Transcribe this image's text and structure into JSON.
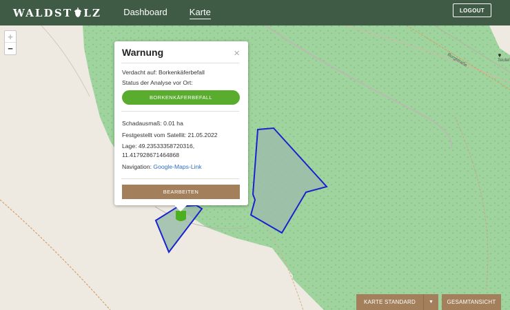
{
  "header": {
    "logo_left": "WALDST",
    "logo_right": "LZ",
    "nav": [
      {
        "label": "Dashboard",
        "active": false
      },
      {
        "label": "Karte",
        "active": true
      }
    ],
    "logout_label": "LOGOUT"
  },
  "map": {
    "zoom_in": "+",
    "zoom_out": "−",
    "street_label": "Burgstraße",
    "place_label": "Teufel",
    "colors": {
      "forest": "#9fd39c",
      "land": "#eeeae2",
      "polygon": "#1a22d0",
      "marker": "#4caf1e"
    }
  },
  "popup": {
    "title": "Warnung",
    "close": "×",
    "suspicion": "Verdacht auf: Borkenkäferbefall",
    "status_label": "Status der Analyse vor Ort:",
    "status_pill": "BORKENKÄFERBEFALL",
    "damage": "Schadausmaß: 0.01 ha",
    "detected": "Festgestellt vom Satellit: 21.05.2022",
    "location_1": "Lage: 49.23533358720316,",
    "location_2": "11.417928671464868",
    "navigation_label": "Navigation: ",
    "navigation_link": "Google-Maps-Link",
    "edit_button": "BEARBEITEN"
  },
  "footer": {
    "map_style_button": "KARTE STANDARD",
    "dropdown_icon": "▼",
    "overview_button": "GESAMTANSICHT"
  }
}
